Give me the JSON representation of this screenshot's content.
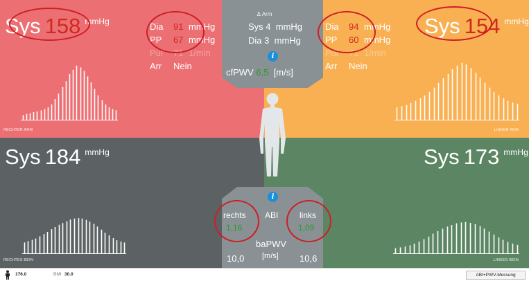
{
  "colors": {
    "right_arm": "#ec6f73",
    "left_arm": "#f8b053",
    "right_leg": "#5c6264",
    "left_leg": "#5c8663",
    "center": "#8a9195",
    "value_red": "#d02a1e",
    "value_green": "#2e9a2e",
    "info_blue": "#1c8fd8",
    "highlight_oval": "#cc1f25"
  },
  "right_arm": {
    "sys_label": "Sys",
    "sys_value": "158",
    "unit": "mmHg",
    "rows": [
      {
        "label": "Dia",
        "value": "91",
        "unit": "mmHg"
      },
      {
        "label": "PP",
        "value": "67",
        "unit": "mmHg"
      },
      {
        "label": "Pul",
        "value": "71",
        "unit": "1/min"
      },
      {
        "label": "Arr",
        "value": "Nein",
        "unit": ""
      }
    ],
    "region_label": "RECHTER ARM",
    "waveform": [
      0.09,
      0.11,
      0.12,
      0.14,
      0.15,
      0.17,
      0.19,
      0.22,
      0.27,
      0.36,
      0.45,
      0.56,
      0.66,
      0.78,
      0.85,
      0.92,
      0.89,
      0.83,
      0.74,
      0.64,
      0.53,
      0.42,
      0.34,
      0.27,
      0.22,
      0.19,
      0.17
    ]
  },
  "left_arm": {
    "sys_label": "Sys",
    "sys_value": "154",
    "unit": "mmHg",
    "rows": [
      {
        "label": "Dia",
        "value": "94",
        "unit": "mmHg"
      },
      {
        "label": "PP",
        "value": "60",
        "unit": "mmHg"
      },
      {
        "label": "Pul",
        "value": "71",
        "unit": "1/min"
      },
      {
        "label": "Arr",
        "value": "Nein",
        "unit": ""
      }
    ],
    "region_label": "LINKER ARM",
    "waveform": [
      0.22,
      0.24,
      0.26,
      0.29,
      0.33,
      0.37,
      0.42,
      0.48,
      0.55,
      0.63,
      0.71,
      0.78,
      0.86,
      0.92,
      0.97,
      0.94,
      0.88,
      0.8,
      0.72,
      0.63,
      0.55,
      0.48,
      0.42,
      0.37,
      0.33,
      0.3,
      0.28
    ]
  },
  "right_leg": {
    "sys_label": "Sys",
    "sys_value": "184",
    "unit": "mmHg",
    "region_label": "RECHTES BEIN",
    "waveform": [
      0.26,
      0.29,
      0.32,
      0.35,
      0.4,
      0.45,
      0.5,
      0.56,
      0.61,
      0.66,
      0.7,
      0.74,
      0.78,
      0.8,
      0.81,
      0.8,
      0.77,
      0.73,
      0.68,
      0.62,
      0.55,
      0.48,
      0.42,
      0.36,
      0.31,
      0.28,
      0.26
    ]
  },
  "left_leg": {
    "sys_label": "Sys",
    "sys_value": "173",
    "unit": "mmHg",
    "region_label": "LINKES BEIN",
    "waveform": [
      0.14,
      0.16,
      0.18,
      0.21,
      0.25,
      0.3,
      0.36,
      0.42,
      0.49,
      0.55,
      0.61,
      0.66,
      0.7,
      0.74,
      0.76,
      0.77,
      0.75,
      0.72,
      0.67,
      0.61,
      0.54,
      0.47,
      0.4,
      0.34,
      0.29,
      0.25,
      0.22
    ]
  },
  "top_center": {
    "title": "Δ Arm",
    "sys_label": "Sys",
    "sys_value": "4",
    "dia_label": "Dia",
    "dia_value": "3",
    "unit": "mmHg",
    "info": "i",
    "cfpwv_label": "cfPWV",
    "cfpwv_value": "6,5",
    "cfpwv_unit": "[m/s]"
  },
  "bottom_center": {
    "info": "i",
    "right_label": "rechts",
    "abi_label": "ABI",
    "left_label": "links",
    "abi_right_value": "1,16",
    "abi_left_value": "1,09",
    "bapwv_label": "baPWV",
    "bapwv_right_value": "10,0",
    "bapwv_unit": "[m/s]",
    "bapwv_left_value": "10,6"
  },
  "status_bar": {
    "height_value": "176.0",
    "bmi_label": "BMI",
    "bmi_value": "30.0",
    "mode_label": "ABI+PWV-Messung"
  }
}
